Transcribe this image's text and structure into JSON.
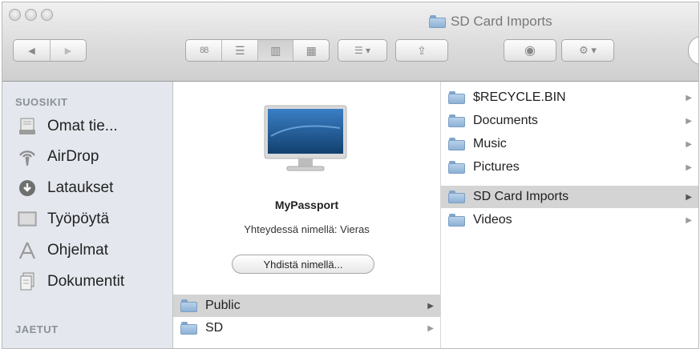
{
  "window": {
    "title": "SD Card Imports",
    "title_icon": "folder-icon"
  },
  "toolbar": {
    "back_label": "◀",
    "forward_label": "▶",
    "view_icon_label": "88",
    "view_list_label": "☰",
    "view_column_label": "▥",
    "view_coverflow_label": "▦",
    "arrange_label": "☰ ▾",
    "share_label": "⇪",
    "quicklook_label": "◉",
    "action_label": "⚙ ▾"
  },
  "sidebar": {
    "favorites_header": "SUOSIKIT",
    "shared_header": "JAETUT",
    "items": [
      {
        "label": "Omat tie...",
        "icon": "documents-drive-icon"
      },
      {
        "label": "AirDrop",
        "icon": "airdrop-icon"
      },
      {
        "label": "Lataukset",
        "icon": "downloads-icon"
      },
      {
        "label": "Työpöytä",
        "icon": "desktop-icon"
      },
      {
        "label": "Ohjelmat",
        "icon": "applications-icon"
      },
      {
        "label": "Dokumentit",
        "icon": "documents-icon"
      }
    ]
  },
  "middle": {
    "device_icon": "monitor-icon",
    "device_name": "MyPassport",
    "status": "Yhteydessä nimellä: Vieras",
    "connect_label": "Yhdistä nimellä...",
    "folders": [
      {
        "name": "Public",
        "selected": true
      },
      {
        "name": "SD",
        "selected": false
      }
    ]
  },
  "right": {
    "folders": [
      {
        "name": "$RECYCLE.BIN",
        "selected": false
      },
      {
        "name": "Documents",
        "selected": false
      },
      {
        "name": "Music",
        "selected": false
      },
      {
        "name": "Pictures",
        "selected": false
      },
      {
        "name": "SD Card Imports",
        "selected": true
      },
      {
        "name": "Videos",
        "selected": false
      }
    ]
  },
  "colors": {
    "sidebar_bg": "#e4e8ee",
    "selection_bg": "#d4d4d4",
    "folder_blue": "#8db1d6"
  }
}
